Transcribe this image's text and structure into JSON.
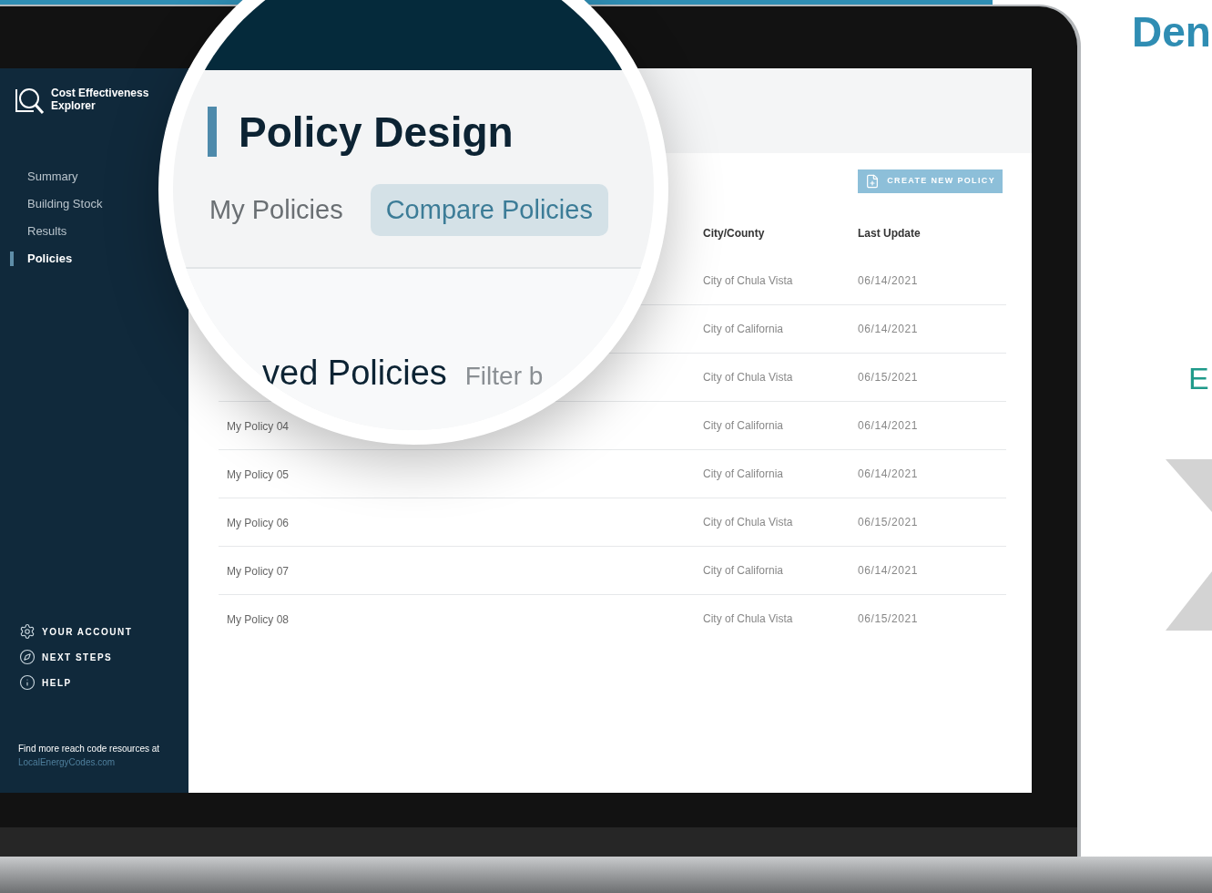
{
  "brand": {
    "name": "Cost Effectiveness Explorer"
  },
  "sidebar": {
    "items": [
      {
        "label": "Summary",
        "selected": false
      },
      {
        "label": "Building Stock",
        "selected": false
      },
      {
        "label": "Results",
        "selected": false
      },
      {
        "label": "Policies",
        "selected": true
      }
    ],
    "links": [
      {
        "label": "YOUR ACCOUNT",
        "kind": "gear"
      },
      {
        "label": "NEXT STEPS",
        "kind": "compass"
      },
      {
        "label": "HELP",
        "kind": "info"
      }
    ],
    "footer": {
      "text": "Find more reach code resources at",
      "link": "LocalEnergyCodes.com"
    }
  },
  "content": {
    "create_button": "CREATE NEW POLICY",
    "table": {
      "columns": [
        "City/County",
        "Last Update"
      ],
      "rows": [
        {
          "city": "City of Chula Vista",
          "updated": "06/14/2021"
        },
        {
          "city": "City of California",
          "updated": "06/14/2021"
        },
        {
          "city": "City of Chula Vista",
          "updated": "06/15/2021"
        },
        {
          "name": "My Policy 04",
          "city": "City of California",
          "updated": "06/14/2021"
        },
        {
          "name": "My Policy 05",
          "city": "City of California",
          "updated": "06/14/2021"
        },
        {
          "name": "My Policy 06",
          "city": "City of Chula Vista",
          "updated": "06/15/2021"
        },
        {
          "name": "My Policy 07",
          "city": "City of California",
          "updated": "06/14/2021"
        },
        {
          "name": "My Policy 08",
          "city": "City of Chula Vista",
          "updated": "06/15/2021"
        }
      ]
    }
  },
  "magnifier": {
    "title": "Policy Design",
    "tabs": [
      {
        "label": "My Policies",
        "selected": false
      },
      {
        "label": "Compare Policies",
        "selected": true
      }
    ],
    "section_title": "ved Policies",
    "filter_label": "Filter b"
  },
  "promo": {
    "heading": "Den",
    "subheading": "E"
  }
}
